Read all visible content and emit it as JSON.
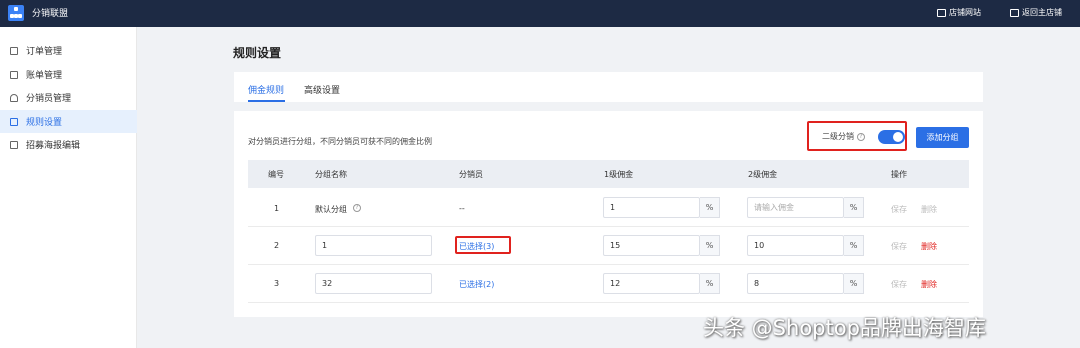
{
  "topbar": {
    "app_title": "分销联盟",
    "links": [
      {
        "label": "店铺网站",
        "icon": "monitor-icon"
      },
      {
        "label": "返回主店铺",
        "icon": "return-store-icon"
      }
    ]
  },
  "sidebar": {
    "items": [
      {
        "label": "订单管理",
        "icon": "order-icon",
        "active": false
      },
      {
        "label": "账单管理",
        "icon": "bill-icon",
        "active": false
      },
      {
        "label": "分销员管理",
        "icon": "user-icon",
        "active": false
      },
      {
        "label": "规则设置",
        "icon": "rules-icon",
        "active": true
      },
      {
        "label": "招募海报编辑",
        "icon": "poster-icon",
        "active": false
      }
    ]
  },
  "main": {
    "title": "规则设置",
    "tabs": [
      {
        "label": "佣金规则",
        "active": true
      },
      {
        "label": "高级设置",
        "active": false
      }
    ],
    "description": "对分销员进行分组，不同分销员可获不同的佣金比例",
    "level2": {
      "label": "二级分销",
      "help": "?",
      "enabled": true
    },
    "add_button": "添加分组",
    "table": {
      "headers": [
        "编号",
        "分组名称",
        "分销员",
        "1级佣金",
        "2级佣金",
        "操作"
      ],
      "rows": [
        {
          "id": "1",
          "name": "默认分组",
          "name_help": "?",
          "members": "--",
          "level1": "1",
          "level1_unit": "%",
          "level2": "",
          "level2_placeholder": "请输入佣金",
          "level2_unit": "%",
          "save": "保存",
          "delete": "删除"
        },
        {
          "id": "2",
          "name": "1",
          "members": "已选择(3)",
          "level1": "15",
          "level1_unit": "%",
          "level2": "10",
          "level2_unit": "%",
          "save": "保存",
          "delete": "删除"
        },
        {
          "id": "3",
          "name": "32",
          "members": "已选择(2)",
          "level1": "12",
          "level1_unit": "%",
          "level2": "8",
          "level2_unit": "%",
          "save": "保存",
          "delete": "删除"
        }
      ]
    }
  },
  "watermark": "头条 @Shoptop品牌出海智库",
  "colors": {
    "primary": "#2b6fe5",
    "topbar": "#1d2a44",
    "highlight": "#e0221e"
  }
}
